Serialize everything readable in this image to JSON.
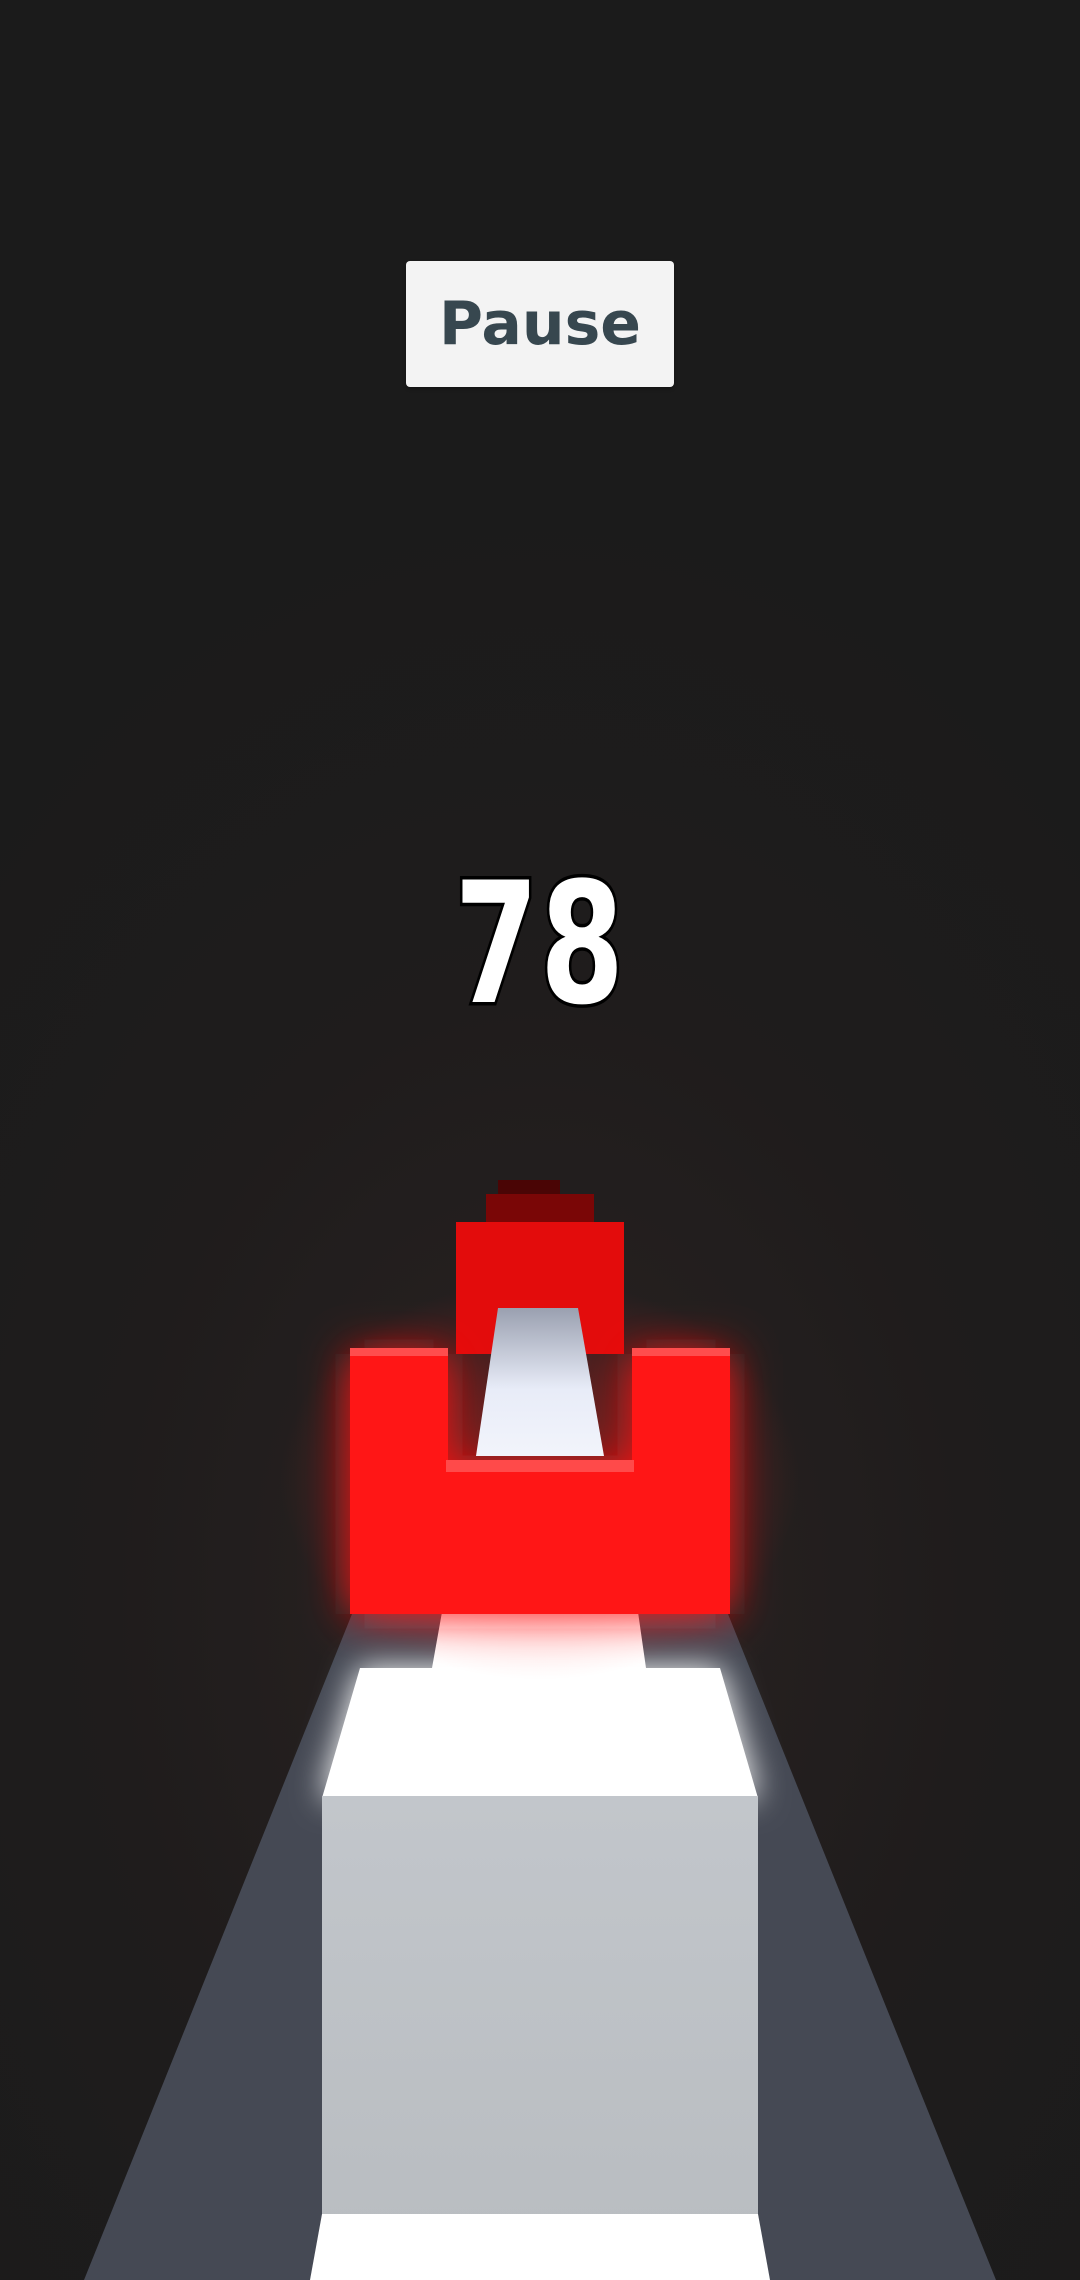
{
  "hud": {
    "pause_label": "Pause",
    "score": "78"
  },
  "colors": {
    "background": "#1b1b1b",
    "obstacle_red": "#ff1010",
    "track_white": "#ffffff",
    "track_side": "#454954",
    "button_bg": "#f3f3f3",
    "button_text": "#37474f"
  }
}
